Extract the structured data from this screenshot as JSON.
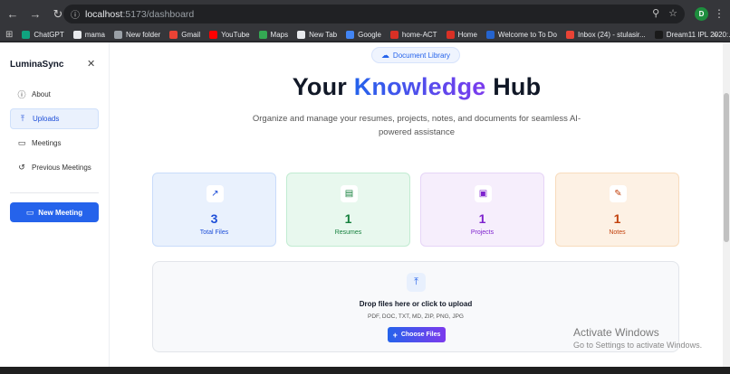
{
  "browser": {
    "url_host": "localhost",
    "url_path": ":5173/dashboard",
    "profile_initial": "D",
    "bookmarks": [
      {
        "label": "ChatGPT",
        "color": "#10a37f"
      },
      {
        "label": "mama",
        "color": "#e8eaed"
      },
      {
        "label": "New folder",
        "color": "#9aa0a6"
      },
      {
        "label": "Gmail",
        "color": "#ea4335"
      },
      {
        "label": "YouTube",
        "color": "#ff0000"
      },
      {
        "label": "Maps",
        "color": "#34a853"
      },
      {
        "label": "New Tab",
        "color": "#e8eaed"
      },
      {
        "label": "Google",
        "color": "#4285f4"
      },
      {
        "label": "home-ACT",
        "color": "#d93025"
      },
      {
        "label": "Home",
        "color": "#d93025"
      },
      {
        "label": "Welcome to To Do",
        "color": "#2564cf"
      },
      {
        "label": "Inbox (24) - stulasir...",
        "color": "#ea4335"
      },
      {
        "label": "Dream11 IPL 2020:...",
        "color": "#1a1a1a"
      }
    ],
    "more": "»"
  },
  "sidebar": {
    "brand": "LuminaSync",
    "close": "✕",
    "items": [
      {
        "label": "About",
        "icon": "info-icon",
        "glyph": "ⓘ"
      },
      {
        "label": "Uploads",
        "icon": "upload-icon",
        "glyph": "⤒"
      },
      {
        "label": "Meetings",
        "icon": "video-icon",
        "glyph": "▭"
      },
      {
        "label": "Previous Meetings",
        "icon": "history-icon",
        "glyph": "↺"
      }
    ],
    "new_meeting": "New Meeting"
  },
  "main": {
    "badge": "Document Library",
    "hero_pre": "Your ",
    "hero_accent": "Knowledge",
    "hero_post": " Hub",
    "subtitle": "Organize and manage your resumes, projects, notes, and documents for seamless AI-powered assistance",
    "cards": [
      {
        "value": "3",
        "label": "Total Files",
        "icon": "trending-up-icon",
        "glyph": "↗"
      },
      {
        "value": "1",
        "label": "Resumes",
        "icon": "file-text-icon",
        "glyph": "▤"
      },
      {
        "value": "1",
        "label": "Projects",
        "icon": "archive-icon",
        "glyph": "▣"
      },
      {
        "value": "1",
        "label": "Notes",
        "icon": "pen-icon",
        "glyph": "✎"
      }
    ],
    "dropzone": {
      "title": "Drop files here or click to upload",
      "formats": "PDF, DOC, TXT, MD, ZIP, PNG, JPG",
      "button": "Choose Files"
    }
  },
  "os": {
    "watermark_title": "Activate Windows",
    "watermark_sub": "Go to Settings to activate Windows."
  }
}
